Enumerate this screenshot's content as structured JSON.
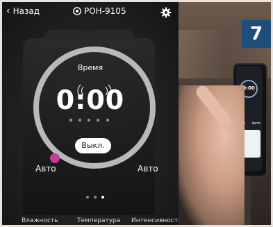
{
  "header": {
    "back_label": "Назад",
    "device_name": "РОН-9105"
  },
  "timer": {
    "title": "Время",
    "value": "0:00",
    "power_button": "Выкл."
  },
  "modes": {
    "left": "Авто",
    "right": "Авто"
  },
  "pager": {
    "page_count": 3,
    "active_index": 2
  },
  "bottom_nav": {
    "humidity": "Влажность",
    "temperature": "Температура",
    "intensity": "Интенсивность"
  },
  "step_badge": "7",
  "colors": {
    "accent_knob": "#c2408f",
    "ring": "#b9b9bb",
    "badge_bg": "#1f4e7d"
  },
  "icons": [
    "back-chevron-icon",
    "device-icon",
    "gear-icon"
  ]
}
